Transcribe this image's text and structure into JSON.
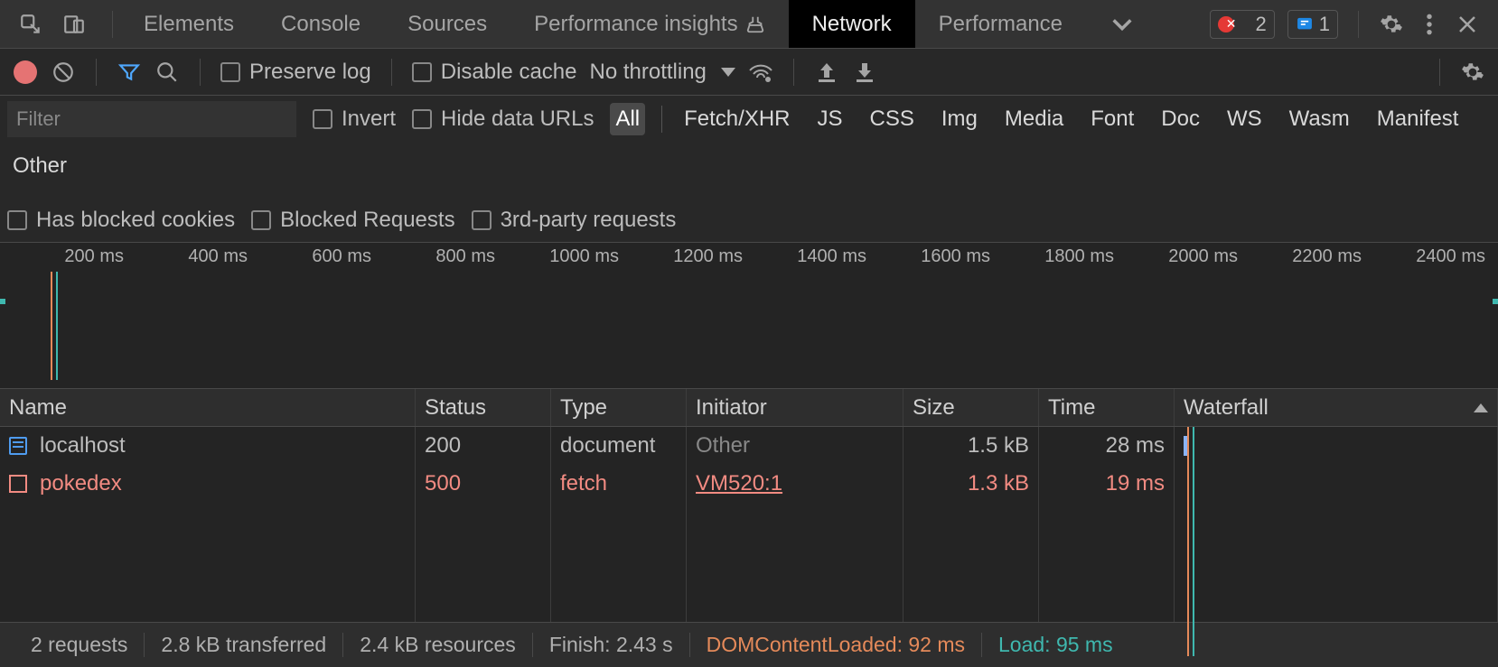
{
  "tabs": {
    "items": [
      "Elements",
      "Console",
      "Sources",
      "Performance insights",
      "Network",
      "Performance"
    ],
    "active": "Network",
    "error_count": "2",
    "info_count": "1"
  },
  "toolbar": {
    "preserve_log": "Preserve log",
    "disable_cache": "Disable cache",
    "throttling": "No throttling"
  },
  "filter": {
    "placeholder": "Filter",
    "invert": "Invert",
    "hide_data_urls": "Hide data URLs",
    "types": [
      "All",
      "Fetch/XHR",
      "JS",
      "CSS",
      "Img",
      "Media",
      "Font",
      "Doc",
      "WS",
      "Wasm",
      "Manifest",
      "Other"
    ],
    "types_active": "All",
    "has_blocked_cookies": "Has blocked cookies",
    "blocked_requests": "Blocked Requests",
    "third_party": "3rd-party requests"
  },
  "timeline": {
    "ticks": [
      "200 ms",
      "400 ms",
      "600 ms",
      "800 ms",
      "1000 ms",
      "1200 ms",
      "1400 ms",
      "1600 ms",
      "1800 ms",
      "2000 ms",
      "2200 ms",
      "2400 ms"
    ]
  },
  "table": {
    "columns": [
      "Name",
      "Status",
      "Type",
      "Initiator",
      "Size",
      "Time",
      "Waterfall"
    ],
    "rows": [
      {
        "name": "localhost",
        "status": "200",
        "type": "document",
        "initiator": "Other",
        "size": "1.5 kB",
        "time": "28 ms",
        "error": false,
        "initiator_link": false
      },
      {
        "name": "pokedex",
        "status": "500",
        "type": "fetch",
        "initiator": "VM520:1",
        "size": "1.3 kB",
        "time": "19 ms",
        "error": true,
        "initiator_link": true
      }
    ]
  },
  "status": {
    "requests": "2 requests",
    "transferred": "2.8 kB transferred",
    "resources": "2.4 kB resources",
    "finish": "Finish: 2.43 s",
    "dcl": "DOMContentLoaded: 92 ms",
    "load": "Load: 95 ms"
  }
}
